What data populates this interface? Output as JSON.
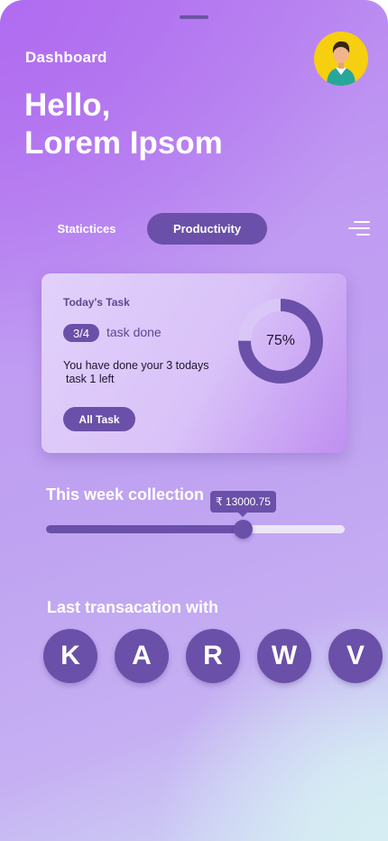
{
  "header": {
    "title": "Dashboard",
    "greeting_line1": "Hello,",
    "greeting_line2": "Lorem Ipsom",
    "avatar_icon": "user-avatar-icon"
  },
  "tabs": [
    {
      "label": "Statictices",
      "active": false
    },
    {
      "label": "Productivity",
      "active": true
    }
  ],
  "menu_icon": "hamburger-menu-icon",
  "task_card": {
    "title": "Today's Task",
    "progress_badge": "3/4",
    "progress_text": "task done",
    "description_line1": "You have done your 3 todays",
    "description_line2": "task 1 left",
    "button_label": "All Task",
    "percent_label": "75%",
    "percent_value": 0.75
  },
  "collection": {
    "title": "This week collection",
    "value_label": "₹ 13000.75",
    "slider_fraction": 0.66
  },
  "transactions": {
    "title": "Last transacation with",
    "contacts": [
      "K",
      "A",
      "R",
      "W",
      "V"
    ]
  },
  "colors": {
    "accent": "#6a50a8",
    "avatar_bg": "#f6cf10",
    "text_on_accent": "#ffffff"
  }
}
